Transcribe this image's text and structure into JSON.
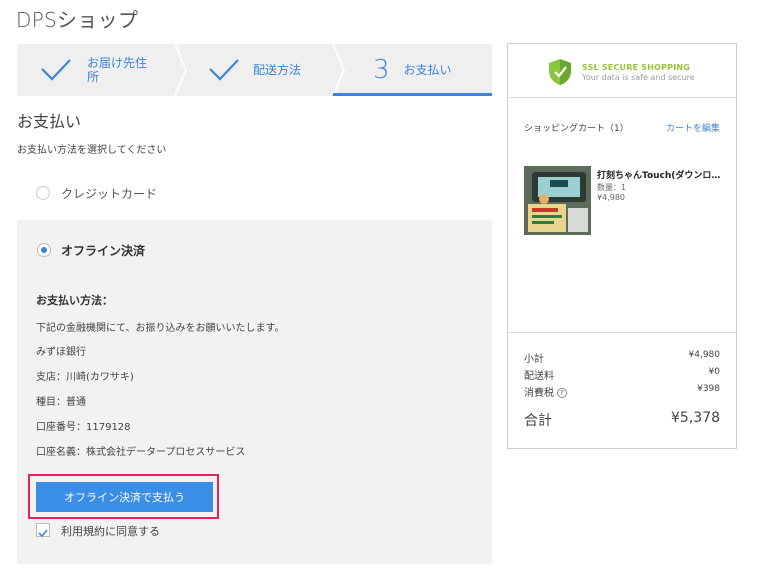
{
  "header": {
    "shop_name": "DPSショップ"
  },
  "steps": [
    {
      "label": "お届け先住所",
      "state": "done"
    },
    {
      "label": "配送方法",
      "state": "done"
    },
    {
      "number": "3",
      "label": "お支払い",
      "state": "active"
    }
  ],
  "payment": {
    "title": "お支払い",
    "subtitle": "お支払い方法を選択してください",
    "options": [
      {
        "label": "クレジットカード",
        "selected": false
      },
      {
        "label": "オフライン決済",
        "selected": true
      }
    ],
    "details": {
      "heading": "お支払い方法：",
      "lines": [
        "下記の金融機関にて、お振り込みをお願いいたします。",
        "みずほ銀行",
        "支店：川崎(カワサキ)",
        "種目：普通",
        "口座番号：1179128",
        "口座名義：株式会社データープロセスサービス"
      ]
    },
    "pay_button_label": "オフライン決済で支払う",
    "terms_label": "利用規約に同意する",
    "terms_checked": true
  },
  "cart": {
    "ssl_title": "SSL SECURE SHOPPING",
    "ssl_subtitle": "Your data is safe and secure",
    "title": "ショッピングカート（1）",
    "edit_label": "カートを編集",
    "item": {
      "name": "打刻ちゃんTouch(ダウンロード版)",
      "qty": "数量：1",
      "price": "¥4,980"
    },
    "summary": {
      "subtotal_label": "小計",
      "subtotal": "¥4,980",
      "shipping_label": "配送料",
      "shipping": "¥0",
      "tax_label": "消費税",
      "tax": "¥398",
      "total_label": "合計",
      "total": "¥5,378"
    }
  },
  "colors": {
    "accent": "#3b86d8",
    "highlight": "#e0245e",
    "ssl_green": "#9bc23c"
  }
}
